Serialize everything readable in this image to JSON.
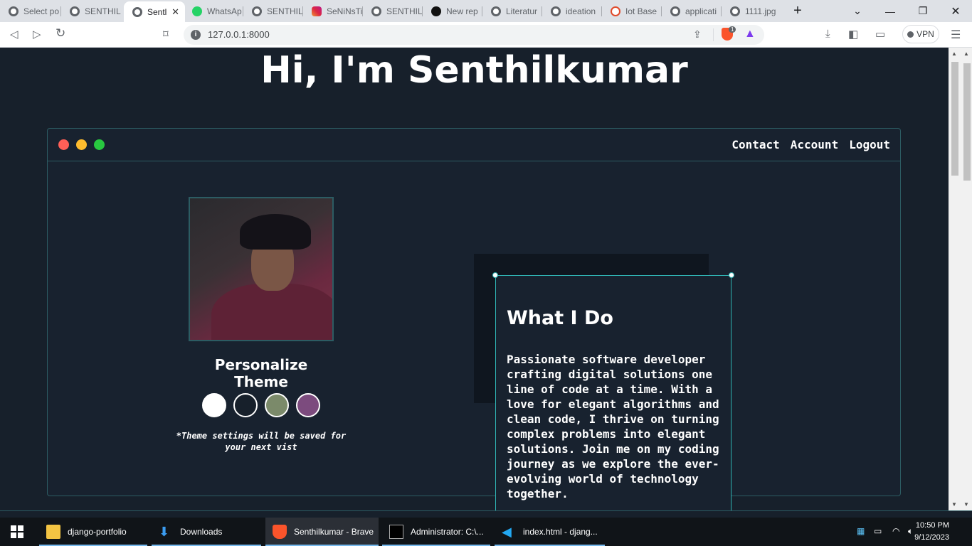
{
  "browser": {
    "tabs": [
      {
        "label": "Select po",
        "icon": "globe-icon"
      },
      {
        "label": "SENTHIL",
        "icon": "globe-icon"
      },
      {
        "label": "Sentl",
        "icon": "globe-icon",
        "active": true
      },
      {
        "label": "WhatsAp",
        "icon": "whatsapp-icon"
      },
      {
        "label": "SENTHIL",
        "icon": "globe-icon"
      },
      {
        "label": "SeNiNsTi",
        "icon": "instagram-icon"
      },
      {
        "label": "SENTHIL",
        "icon": "globe-icon"
      },
      {
        "label": "New rep",
        "icon": "github-icon"
      },
      {
        "label": "Literatur",
        "icon": "globe-icon"
      },
      {
        "label": "ideation",
        "icon": "globe-icon"
      },
      {
        "label": "Iot Base",
        "icon": "brave-icon"
      },
      {
        "label": "applicati",
        "icon": "globe-icon"
      },
      {
        "label": "1111.jpg",
        "icon": "globe-icon"
      }
    ],
    "url": "127.0.0.1:8000",
    "vpn_label": "VPN",
    "shield_count": "1"
  },
  "page": {
    "hero_title": "Hi, I'm Senthilkumar",
    "nav": [
      "Contact",
      "Account",
      "Logout"
    ],
    "personalize_title": "Personalize Theme",
    "theme_colors": [
      "#ffffff",
      "#17202b",
      "#7b8a6a",
      "#7c4b7e"
    ],
    "theme_note": "*Theme settings will be saved for your next vist",
    "card_title": "What I Do",
    "card_text": "Passionate software developer crafting digital solutions one line of code at a time. With a love for elegant algorithms and clean code, I thrive on turning complex problems into elegant solutions. Join me on my coding journey as we explore the ever-evolving world of technology together."
  },
  "taskbar": {
    "items": [
      "django-portfolio",
      "Downloads",
      "Senthilkumar - Brave",
      "Administrator: C:\\...",
      "index.html - djang..."
    ],
    "time": "10:50 PM",
    "date": "9/12/2023"
  },
  "colors": {
    "accent": "#2fb3b3",
    "page_bg": "#17202b",
    "window_border": "#2c5c63"
  }
}
